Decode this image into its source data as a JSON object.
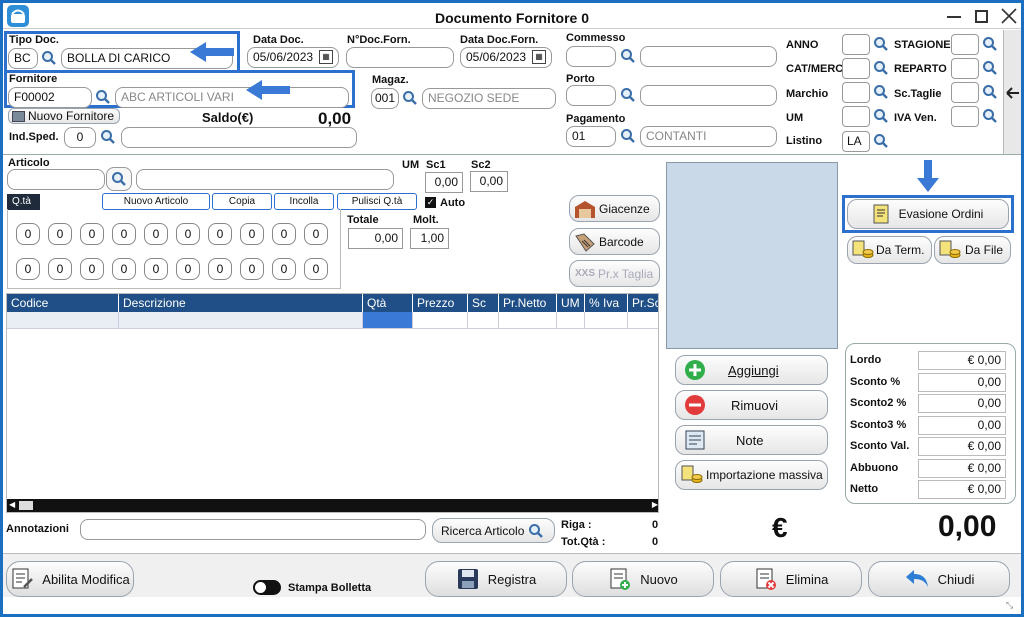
{
  "window": {
    "title": "Documento Fornitore 0"
  },
  "header": {
    "tipo_doc": {
      "label": "Tipo Doc.",
      "code": "BC",
      "desc": "BOLLA DI CARICO"
    },
    "data_doc": {
      "label": "Data Doc.",
      "value": "05/06/2023"
    },
    "n_doc_forn": {
      "label": "N°Doc.Forn.",
      "value": ""
    },
    "data_doc_forn": {
      "label": "Data Doc.Forn.",
      "value": "05/06/2023"
    },
    "commesso": {
      "label": "Commesso"
    },
    "fornitore": {
      "label": "Fornitore",
      "code": "F00002",
      "desc": "ABC ARTICOLI VARI"
    },
    "nuovo_fornitore": "Nuovo Fornitore",
    "saldo_label": "Saldo(€)",
    "saldo_value": "0,00",
    "ind_sped": {
      "label": "Ind.Sped.",
      "value": "0"
    },
    "magaz": {
      "label": "Magaz.",
      "code": "001",
      "desc": "NEGOZIO SEDE"
    },
    "porto": {
      "label": "Porto"
    },
    "pagamento": {
      "label": "Pagamento",
      "code": "01",
      "desc": "CONTANTI"
    },
    "right_filters": {
      "anno": "ANNO",
      "cat_merc": "CAT/MERC",
      "marchio": "Marchio",
      "um": "UM",
      "listino": "Listino",
      "listino_value": "LA",
      "stagione": "STAGIONE",
      "reparto": "REPARTO",
      "sc_taglie": "Sc.Taglie",
      "iva_ven": "IVA Ven."
    }
  },
  "articolo": {
    "label": "Articolo",
    "um": "UM",
    "sc1": "Sc1",
    "sc1_value": "0,00",
    "sc2": "Sc2",
    "sc2_value": "0,00",
    "qta_tab": "Q.tà",
    "nuovo_articolo": "Nuovo Articolo",
    "copia": "Copia",
    "incolla": "Incolla",
    "pulisci": "Pulisci Q.tà",
    "auto": "Auto",
    "totale_label": "Totale",
    "totale_value": "0,00",
    "molt_label": "Molt.",
    "molt_value": "1,00",
    "qty_row1": [
      "0",
      "0",
      "0",
      "0",
      "0",
      "0",
      "0",
      "0",
      "0",
      "0"
    ],
    "qty_row2": [
      "0",
      "0",
      "0",
      "0",
      "0",
      "0",
      "0",
      "0",
      "0",
      "0"
    ]
  },
  "side_buttons": {
    "giacenze": "Giacenze",
    "barcode": "Barcode",
    "prx_taglia": "Pr.x Taglia",
    "xxs": "XXS"
  },
  "right_panel": {
    "evasione": "Evasione Ordini",
    "da_term": "Da Term.",
    "da_file": "Da File"
  },
  "table": {
    "columns": [
      "Codice",
      "Descrizione",
      "Qtà",
      "Prezzo",
      "Sc",
      "Pr.Netto",
      "UM",
      "% Iva",
      "Pr.Sc"
    ]
  },
  "actions": {
    "aggiungi": "Aggiungi",
    "rimuovi": "Rimuovi",
    "note": "Note",
    "importazione": "Importazione massiva"
  },
  "totals": {
    "rows": [
      {
        "label": "Lordo",
        "value": "€ 0,00"
      },
      {
        "label": "Sconto %",
        "value": "0,00"
      },
      {
        "label": "Sconto2 %",
        "value": "0,00"
      },
      {
        "label": "Sconto3 %",
        "value": "0,00"
      },
      {
        "label": "Sconto Val.",
        "value": "€ 0,00"
      },
      {
        "label": "Abbuono",
        "value": "€ 0,00"
      },
      {
        "label": "Netto",
        "value": "€ 0,00"
      }
    ],
    "euro": "€",
    "big_total": "0,00"
  },
  "footer": {
    "annotazioni": "Annotazioni",
    "ricerca_articolo": "Ricerca Articolo",
    "riga_label": "Riga :",
    "riga_value": "0",
    "totqta_label": "Tot.Qtà :",
    "totqta_value": "0",
    "abilita_modifica": "Abilita Modifica",
    "stampa_bolletta": "Stampa Bolletta",
    "registra": "Registra",
    "nuovo": "Nuovo",
    "elimina": "Elimina",
    "chiudi": "Chiudi"
  },
  "colors": {
    "accent": "#2b6fcf",
    "table_header": "#1f4f86",
    "selected_cell": "#3a7ad6",
    "preview_bg": "#c9d9e8"
  }
}
